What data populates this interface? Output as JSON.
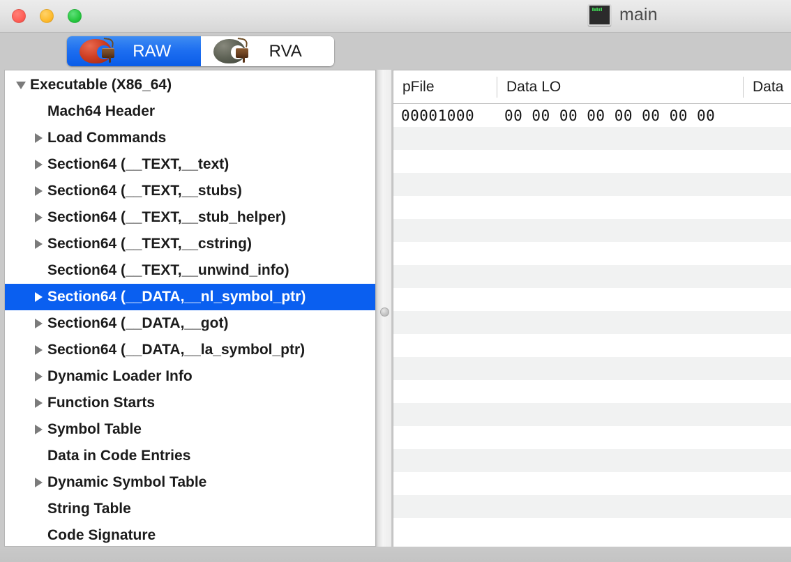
{
  "window": {
    "title": "main",
    "doc_icon": "terminal-icon",
    "traffic_lights": [
      {
        "name": "close",
        "color": "#ff5f57"
      },
      {
        "name": "minimize",
        "color": "#febc2e"
      },
      {
        "name": "zoom",
        "color": "#28c840"
      }
    ]
  },
  "toolbar": {
    "segments": [
      {
        "label": "RAW",
        "icon": "apple-chocolate-icon",
        "selected": true
      },
      {
        "label": "RVA",
        "icon": "apple-chocolate-gray-icon",
        "selected": false
      }
    ],
    "selected_color": "#0a5ce8"
  },
  "sidebar": {
    "items": [
      {
        "label": "Executable  (X86_64)",
        "indent": 0,
        "disclosure": "down",
        "selected": false
      },
      {
        "label": "Mach64 Header",
        "indent": 1,
        "disclosure": "none",
        "selected": false
      },
      {
        "label": "Load Commands",
        "indent": 1,
        "disclosure": "right",
        "selected": false
      },
      {
        "label": "Section64 (__TEXT,__text)",
        "indent": 1,
        "disclosure": "right",
        "selected": false
      },
      {
        "label": "Section64 (__TEXT,__stubs)",
        "indent": 1,
        "disclosure": "right",
        "selected": false
      },
      {
        "label": "Section64 (__TEXT,__stub_helper)",
        "indent": 1,
        "disclosure": "right",
        "selected": false
      },
      {
        "label": "Section64 (__TEXT,__cstring)",
        "indent": 1,
        "disclosure": "right",
        "selected": false
      },
      {
        "label": "Section64 (__TEXT,__unwind_info)",
        "indent": 1,
        "disclosure": "none",
        "selected": false
      },
      {
        "label": "Section64 (__DATA,__nl_symbol_ptr)",
        "indent": 1,
        "disclosure": "right",
        "selected": true
      },
      {
        "label": "Section64 (__DATA,__got)",
        "indent": 1,
        "disclosure": "right",
        "selected": false
      },
      {
        "label": "Section64 (__DATA,__la_symbol_ptr)",
        "indent": 1,
        "disclosure": "right",
        "selected": false
      },
      {
        "label": "Dynamic Loader Info",
        "indent": 1,
        "disclosure": "right",
        "selected": false
      },
      {
        "label": "Function Starts",
        "indent": 1,
        "disclosure": "right",
        "selected": false
      },
      {
        "label": "Symbol Table",
        "indent": 1,
        "disclosure": "right",
        "selected": false
      },
      {
        "label": "Data in Code Entries",
        "indent": 1,
        "disclosure": "none",
        "selected": false
      },
      {
        "label": "Dynamic Symbol Table",
        "indent": 1,
        "disclosure": "right",
        "selected": false
      },
      {
        "label": "String Table",
        "indent": 1,
        "disclosure": "none",
        "selected": false
      },
      {
        "label": "Code Signature",
        "indent": 1,
        "disclosure": "none",
        "selected": false
      }
    ],
    "selection_color": "#0a5ff0"
  },
  "table": {
    "columns": [
      {
        "key": "pFile",
        "label": "pFile"
      },
      {
        "key": "data_lo",
        "label": "Data LO"
      },
      {
        "key": "data_hi",
        "label": "Data"
      }
    ],
    "rows": [
      {
        "pFile": "00001000",
        "data_lo": "00 00 00 00 00 00 00 00",
        "data_hi": ""
      },
      {
        "pFile": "",
        "data_lo": "",
        "data_hi": ""
      },
      {
        "pFile": "",
        "data_lo": "",
        "data_hi": ""
      },
      {
        "pFile": "",
        "data_lo": "",
        "data_hi": ""
      },
      {
        "pFile": "",
        "data_lo": "",
        "data_hi": ""
      },
      {
        "pFile": "",
        "data_lo": "",
        "data_hi": ""
      },
      {
        "pFile": "",
        "data_lo": "",
        "data_hi": ""
      },
      {
        "pFile": "",
        "data_lo": "",
        "data_hi": ""
      },
      {
        "pFile": "",
        "data_lo": "",
        "data_hi": ""
      },
      {
        "pFile": "",
        "data_lo": "",
        "data_hi": ""
      },
      {
        "pFile": "",
        "data_lo": "",
        "data_hi": ""
      },
      {
        "pFile": "",
        "data_lo": "",
        "data_hi": ""
      },
      {
        "pFile": "",
        "data_lo": "",
        "data_hi": ""
      },
      {
        "pFile": "",
        "data_lo": "",
        "data_hi": ""
      },
      {
        "pFile": "",
        "data_lo": "",
        "data_hi": ""
      },
      {
        "pFile": "",
        "data_lo": "",
        "data_hi": ""
      },
      {
        "pFile": "",
        "data_lo": "",
        "data_hi": ""
      },
      {
        "pFile": "",
        "data_lo": "",
        "data_hi": ""
      },
      {
        "pFile": "",
        "data_lo": "",
        "data_hi": ""
      }
    ]
  }
}
